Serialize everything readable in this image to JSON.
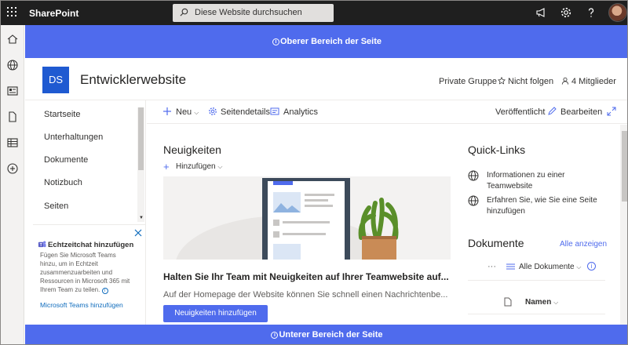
{
  "suitebar": {
    "brand": "SharePoint",
    "search_placeholder": "Diese Website durchsuchen"
  },
  "bands": {
    "top": "Oberer Bereich der Seite",
    "bottom": "Unterer Bereich der Seite"
  },
  "site": {
    "logo_initials": "DS",
    "title": "Entwicklerwebsite",
    "privacy": "Private Gruppe",
    "follow": "Nicht folgen",
    "members": "4 Mitglieder"
  },
  "nav": {
    "items": [
      "Startseite",
      "Unterhaltungen",
      "Dokumente",
      "Notizbuch",
      "Seiten"
    ]
  },
  "teams": {
    "title": "Echtzeitchat hinzufügen",
    "desc": "Fügen Sie Microsoft Teams hinzu, um in Echtzeit zusammenzuarbeiten und Ressourcen in Microsoft 365 mit Ihrem Team zu teilen.",
    "link": "Microsoft Teams hinzufügen"
  },
  "commandbar": {
    "new": "Neu",
    "details": "Seitendetails",
    "analytics": "Analytics",
    "status": "Veröffentlicht",
    "edit": "Bearbeiten"
  },
  "news": {
    "heading": "Neuigkeiten",
    "add": "Hinzufügen",
    "title": "Halten Sie Ihr Team mit Neuigkeiten auf Ihrer Teamwebsite auf...",
    "desc": "Auf der Homepage der Website können Sie schnell einen Nachrichtenbe...",
    "button": "Neuigkeiten hinzufügen"
  },
  "quicklinks": {
    "heading": "Quick-Links",
    "items": [
      "Informationen zu einer Teamwebsite",
      "Erfahren Sie, wie Sie eine Seite hinzufügen"
    ]
  },
  "documents": {
    "heading": "Dokumente",
    "see_all": "Alle anzeigen",
    "more": "···",
    "view": "Alle Dokumente",
    "col_name": "Namen"
  },
  "colors": {
    "accent": "#4f6bed",
    "suitebar": "#1f1f1f",
    "logo": "#1f5ad1"
  }
}
